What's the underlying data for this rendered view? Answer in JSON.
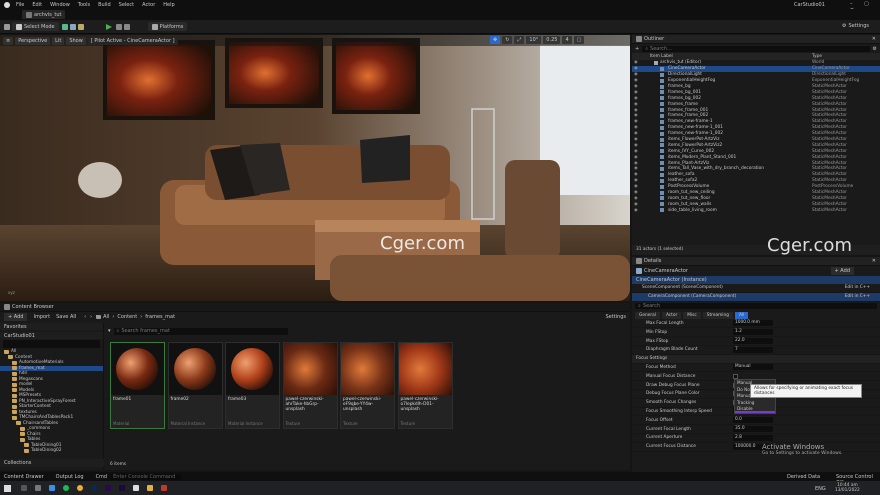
{
  "window": {
    "project_tab": "archvis_tut",
    "project_name": "CarStudio01"
  },
  "menu": [
    "File",
    "Edit",
    "Window",
    "Tools",
    "Build",
    "Select",
    "Actor",
    "Help"
  ],
  "toolbar": {
    "save": "",
    "select_mode": "Select Mode",
    "platforms": "Platforms",
    "settings": "Settings"
  },
  "viewport": {
    "perspective": "Perspective",
    "lit": "Lit",
    "show": "Show",
    "pilot": "[ Pilot Active - CineCameraActor ]",
    "snap_angle": "10°",
    "snap_scale": "0.25",
    "cam_speed": "4",
    "watermark": "Cger.com",
    "axes": "xyz"
  },
  "outliner": {
    "title": "Outliner",
    "search_placeholder": "Search...",
    "col_label": "Item Label",
    "col_type": "Type",
    "items": [
      {
        "label": "archvis_tut (Editor)",
        "type": "World"
      },
      {
        "label": "CineCameraActor",
        "type": "CineCameraActor",
        "selected": true
      },
      {
        "label": "DirectionalLight",
        "type": "DirectionalLight"
      },
      {
        "label": "ExponentialHeightFog",
        "type": "ExponentialHeightFog"
      },
      {
        "label": "frames_bg",
        "type": "StaticMeshActor"
      },
      {
        "label": "frames_bg_001",
        "type": "StaticMeshActor"
      },
      {
        "label": "frames_bg_002",
        "type": "StaticMeshActor"
      },
      {
        "label": "frames_frame",
        "type": "StaticMeshActor"
      },
      {
        "label": "frames_frame_001",
        "type": "StaticMeshActor"
      },
      {
        "label": "frames_frame_002",
        "type": "StaticMeshActor"
      },
      {
        "label": "frames_new-frame-1",
        "type": "StaticMeshActor"
      },
      {
        "label": "frames_new-frame-1_001",
        "type": "StaticMeshActor"
      },
      {
        "label": "frames_new-frame-1_002",
        "type": "StaticMeshActor"
      },
      {
        "label": "items_FlowerPot-ArtzViz",
        "type": "StaticMeshActor"
      },
      {
        "label": "items_FlowerPot-ArtzViz2",
        "type": "StaticMeshActor"
      },
      {
        "label": "items_IVY_Curve_002",
        "type": "StaticMeshActor"
      },
      {
        "label": "items_Modern_Plant_Stand_001",
        "type": "StaticMeshActor"
      },
      {
        "label": "items_Plant-ArtzViz",
        "type": "StaticMeshActor"
      },
      {
        "label": "items_Tall_Vase_with_dry_branch_decoration",
        "type": "StaticMeshActor"
      },
      {
        "label": "leather_sofa",
        "type": "StaticMeshActor"
      },
      {
        "label": "leather_sofa2",
        "type": "StaticMeshActor"
      },
      {
        "label": "PostProcessVolume",
        "type": "PostProcessVolume"
      },
      {
        "label": "room_tut_new_ceiling",
        "type": "StaticMeshActor"
      },
      {
        "label": "room_tut_new_floor",
        "type": "StaticMeshActor"
      },
      {
        "label": "room_tut_new_walls",
        "type": "StaticMeshActor"
      },
      {
        "label": "side_table_living_room",
        "type": "StaticMeshActor"
      }
    ],
    "count": "31 actors (1 selected)",
    "watermark": "Cger.com"
  },
  "details": {
    "title": "Details",
    "actor_name": "CineCameraActor",
    "add": "+ Add",
    "instance": "CineCameraActor (Instance)",
    "components": [
      {
        "label": "SceneComponent (SceneComponent)",
        "link": "Edit in C++"
      },
      {
        "label": "CameraComponent (CameraComponent)",
        "link": "Edit in C++"
      }
    ],
    "search_placeholder": "Search",
    "tabs": [
      "General",
      "Actor",
      "Misc",
      "Streaming",
      "All"
    ],
    "fields": [
      {
        "label": "Max Focal Length",
        "value": "1000.0 mm"
      },
      {
        "label": "Min FStop",
        "value": "1.2"
      },
      {
        "label": "Max FStop",
        "value": "22.0"
      },
      {
        "label": "Diaphragm Blade Count",
        "value": "7"
      }
    ],
    "section_focus": "Focus Settings",
    "focus_fields": [
      {
        "label": "Focus Method",
        "value": "Manual"
      },
      {
        "label": "Manual Focus Distance",
        "value": ""
      },
      {
        "label": "Draw Debug Focus Plane",
        "value": ""
      },
      {
        "label": "Debug Focus Plane Color",
        "value": ""
      },
      {
        "label": "Smooth Focus Changes",
        "value": ""
      },
      {
        "label": "Focus Smoothing Interp Speed",
        "value": "8.0"
      },
      {
        "label": "Focus Offset",
        "value": "0.0"
      },
      {
        "label": "Current Focal Length",
        "value": "35.0"
      },
      {
        "label": "Current Aperture",
        "value": "2.8"
      },
      {
        "label": "Current Focus Distance",
        "value": "100000.0"
      }
    ],
    "dropdown_options": [
      "Manual",
      "Do Not Override",
      "Manual",
      "Tracking",
      "Disable"
    ],
    "tooltip": "Allows for specifying or animating exact focus distances",
    "activate1": "Activate Windows",
    "activate2": "Go to Settings to activate Windows."
  },
  "content_browser": {
    "title": "Content Browser",
    "add": "+ Add",
    "import": "Import",
    "save_all": "Save All",
    "settings": "Settings",
    "breadcrumb": [
      "All",
      "Content",
      "frames_mat"
    ],
    "search_placeholder": "Search frames_mat",
    "favorites": "Favorites",
    "project": "CarStudio01",
    "collections": "Collections",
    "tree": [
      {
        "label": "All",
        "depth": 0
      },
      {
        "label": "Content",
        "depth": 1
      },
      {
        "label": "AutomotiveMaterials",
        "depth": 2
      },
      {
        "label": "frames_mat",
        "depth": 2,
        "selected": true
      },
      {
        "label": "hdri",
        "depth": 2
      },
      {
        "label": "Megascans",
        "depth": 2
      },
      {
        "label": "model",
        "depth": 2
      },
      {
        "label": "Models",
        "depth": 2
      },
      {
        "label": "MSPresets",
        "depth": 2
      },
      {
        "label": "PN_InteractiveSprayForest",
        "depth": 2
      },
      {
        "label": "StarterContent",
        "depth": 2
      },
      {
        "label": "textures",
        "depth": 2
      },
      {
        "label": "TMChairsAndTablesPack1",
        "depth": 2
      },
      {
        "label": "ChairsandTables",
        "depth": 3
      },
      {
        "label": "_commons",
        "depth": 4
      },
      {
        "label": "Chairs",
        "depth": 4
      },
      {
        "label": "Tables",
        "depth": 4
      },
      {
        "label": "TableDining01",
        "depth": 5
      },
      {
        "label": "TableDining02",
        "depth": 5
      }
    ],
    "assets": [
      {
        "name": "frame01",
        "type": "Material",
        "kind": "sphere",
        "color": "#7a2a12"
      },
      {
        "name": "frame02",
        "type": "Material Instance",
        "kind": "sphere",
        "color": "#8a3a1a"
      },
      {
        "name": "frame03",
        "type": "Material Instance",
        "kind": "sphere",
        "color": "#b0401a"
      },
      {
        "name": "pawel-czerwinski-ahrTake-hbGrp-unsplash",
        "type": "Texture",
        "kind": "tex",
        "color": "#6a2a14"
      },
      {
        "name": "pawel-czerwinski-eF9qbe-YY4w-unsplash",
        "type": "Texture",
        "kind": "tex",
        "color": "#7a3418"
      },
      {
        "name": "pawel-czerwinski-o7lepkdIh-D01-unsplash",
        "type": "Texture",
        "kind": "tex",
        "color": "#a03818"
      }
    ],
    "count": "6 items"
  },
  "statusbar": {
    "content_drawer": "Content Drawer",
    "output_log": "Output Log",
    "cmd": "Cmd",
    "console_placeholder": "Enter Console Command",
    "derived_data": "Derived Data",
    "source_control": "Source Control Off"
  },
  "taskbar": {
    "time": "10:44 am",
    "date": "13/01/2022",
    "lang": "ENG"
  }
}
